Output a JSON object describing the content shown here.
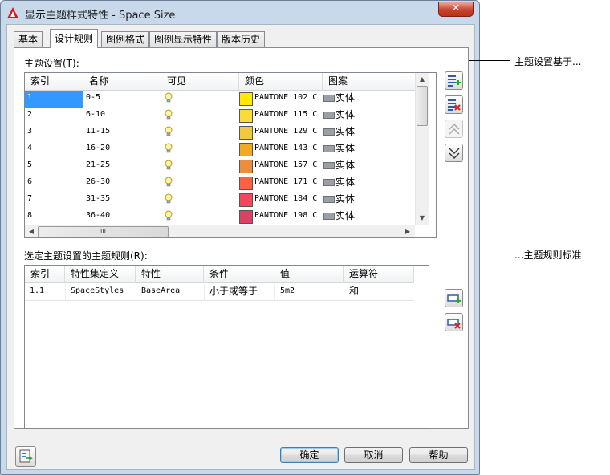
{
  "window": {
    "title": "显示主题样式特性 - Space Size",
    "close_label": "✕"
  },
  "tabs": [
    {
      "label": "基本"
    },
    {
      "label": "设计规则"
    },
    {
      "label": "图例格式"
    },
    {
      "label": "图例显示特性"
    },
    {
      "label": "版本历史"
    }
  ],
  "theme_settings": {
    "label": "主题设置(T):",
    "columns": [
      "索引",
      "名称",
      "可见",
      "颜色",
      "图案"
    ],
    "rows": [
      {
        "index": "1",
        "name": "0-5",
        "color_name": "PANTONE 102 C",
        "swatch": "#ffea00",
        "pattern": "实体"
      },
      {
        "index": "2",
        "name": "6-10",
        "color_name": "PANTONE 115 C",
        "swatch": "#fbdb36",
        "pattern": "实体"
      },
      {
        "index": "3",
        "name": "11-15",
        "color_name": "PANTONE 129 C",
        "swatch": "#f3c83a",
        "pattern": "实体"
      },
      {
        "index": "4",
        "name": "16-20",
        "color_name": "PANTONE 143 C",
        "swatch": "#f1aa22",
        "pattern": "实体"
      },
      {
        "index": "5",
        "name": "21-25",
        "color_name": "PANTONE 157 C",
        "swatch": "#ec8e40",
        "pattern": "实体"
      },
      {
        "index": "6",
        "name": "26-30",
        "color_name": "PANTONE 171 C",
        "swatch": "#fb6244",
        "pattern": "实体"
      },
      {
        "index": "7",
        "name": "31-35",
        "color_name": "PANTONE 184 C",
        "swatch": "#f3475f",
        "pattern": "实体"
      },
      {
        "index": "8",
        "name": "36-40",
        "color_name": "PANTONE 198 C",
        "swatch": "#de4063",
        "pattern": "实体"
      }
    ],
    "hscroll_grip": "III"
  },
  "theme_rules": {
    "label": "选定主题设置的主题规则(R):",
    "columns": [
      "索引",
      "特性集定义",
      "特性",
      "条件",
      "值",
      "运算符"
    ],
    "rows": [
      {
        "index": "1.1",
        "property_set": "SpaceStyles",
        "property": "BaseArea",
        "condition": "小于或等于",
        "value": "5m2",
        "operator": "和"
      }
    ]
  },
  "buttons": {
    "ok": "确定",
    "cancel": "取消",
    "help": "帮助"
  },
  "callouts": {
    "theme_basis": "主题设置基于...",
    "rule_criteria": "...主题规则标准"
  }
}
